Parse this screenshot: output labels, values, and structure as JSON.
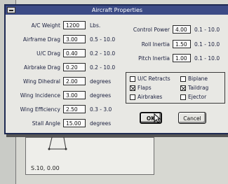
{
  "dialog": {
    "title": "Aircraft Properties",
    "left_fields": [
      {
        "label": "A/C Weight",
        "value": "1200",
        "range": "Lbs."
      },
      {
        "label": "Airframe Drag",
        "value": "3.00",
        "range": "0.5 - 10.0"
      },
      {
        "label": "U/C Drag",
        "value": "0.40",
        "range": "0.2 - 10.0"
      },
      {
        "label": "Airbrake Drag",
        "value": "0.20",
        "range": "0.2 - 10.0"
      },
      {
        "label": "Wing Dihedral",
        "value": "2.00",
        "range": "degrees"
      },
      {
        "label": "Wing Incidence",
        "value": "3.00",
        "range": "degrees"
      },
      {
        "label": "Wing Efficiency",
        "value": "2.50",
        "range": "0.3 - 3.0"
      },
      {
        "label": "Stall Angle",
        "value": "15.00",
        "range": "degrees"
      }
    ],
    "right_fields": [
      {
        "label": "Control Power",
        "value": "4.00",
        "range": "0.1 - 10.0"
      },
      {
        "label": "Roll Inertia",
        "value": "1.50",
        "range": "0.1 - 10.0"
      },
      {
        "label": "Pitch Inertia",
        "value": "1.00",
        "range": "0.1 - 10.0"
      }
    ],
    "options": [
      {
        "label": "U/C Retracts",
        "checked": false
      },
      {
        "label": "Biplane",
        "checked": false
      },
      {
        "label": "Flaps",
        "checked": true
      },
      {
        "label": "Taildrag",
        "checked": true
      },
      {
        "label": "Airbrakes",
        "checked": false
      },
      {
        "label": "Ejector",
        "checked": false
      }
    ],
    "ok_label": "OK",
    "cancel_label": "Cancel"
  },
  "background": {
    "status_text": "S.10,  0.00"
  }
}
